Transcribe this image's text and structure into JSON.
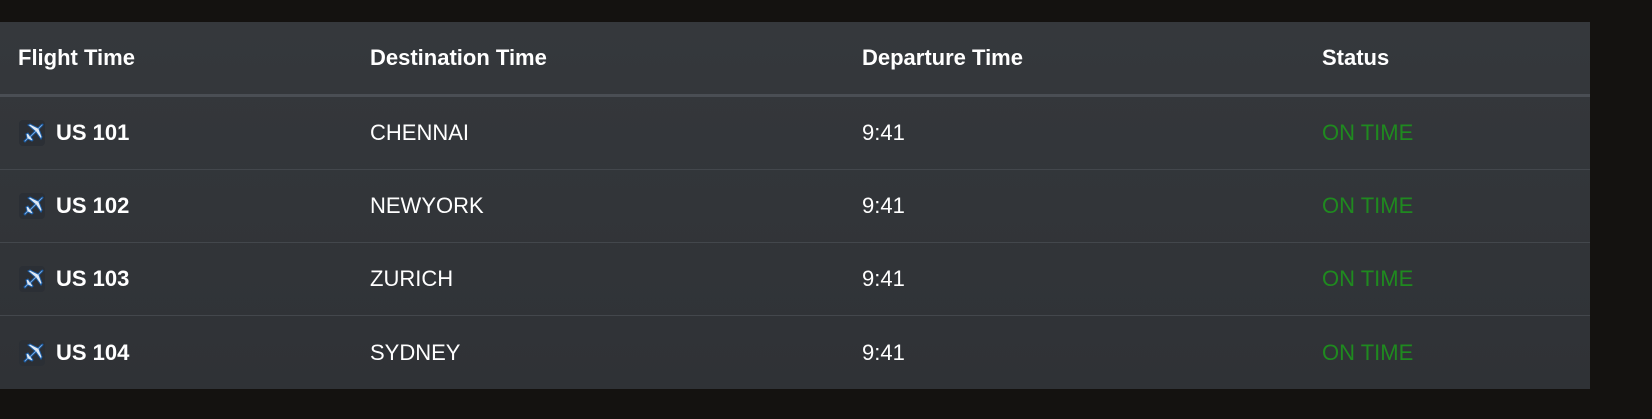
{
  "header": {
    "col_flight": "Flight Time",
    "col_destination": "Destination Time",
    "col_departure": "Departure Time",
    "col_status": "Status"
  },
  "rows": [
    {
      "flight": "US 101",
      "destination": "CHENNAI",
      "departure": "9:41",
      "status": "ON TIME"
    },
    {
      "flight": "US 102",
      "destination": "NEWYORK",
      "departure": "9:41",
      "status": "ON TIME"
    },
    {
      "flight": "US 103",
      "destination": "ZURICH",
      "departure": "9:41",
      "status": "ON TIME"
    },
    {
      "flight": "US 104",
      "destination": "SYDNEY",
      "departure": "9:41",
      "status": "ON TIME"
    }
  ],
  "icons": {
    "flight": "airplane-icon"
  },
  "colors": {
    "status_on_time": "#1f8a1f",
    "background": "#141210",
    "board": "#33363a"
  }
}
